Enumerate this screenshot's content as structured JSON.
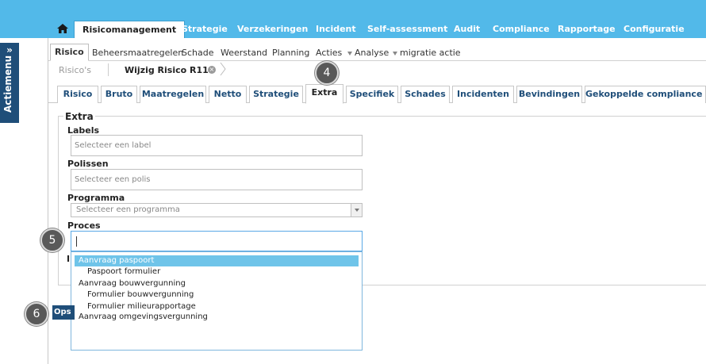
{
  "topnav": {
    "active": "Risicomanagement",
    "tabs": [
      "Strategie",
      "Verzekeringen",
      "Incident",
      "Self-assessment",
      "Audit",
      "Compliance",
      "Rapportage",
      "Configuratie"
    ]
  },
  "actiemenu": {
    "label": "Actiemenu",
    "chevron": "»"
  },
  "subnav": {
    "active": "Risico",
    "items": [
      "Beheersmaatregelen",
      "Schade",
      "Weerstand",
      "Planning",
      "Acties",
      "Analyse",
      "migratie actie"
    ]
  },
  "breadcrumb": {
    "parent": "Risico's",
    "current": "Wijzig Risico R11*"
  },
  "badges": [
    "4",
    "5",
    "6"
  ],
  "detail_tabs": {
    "items": [
      "Risico",
      "Bruto",
      "Maatregelen",
      "Netto",
      "Strategie",
      "Extra",
      "Specifiek",
      "Schades",
      "Incidenten",
      "Bevindingen",
      "Gekoppelde compliance it..."
    ],
    "active_index": 5
  },
  "form": {
    "legend": "Extra",
    "labels_label": "Labels",
    "labels_placeholder": "Selecteer een label",
    "polissen_label": "Polissen",
    "polissen_placeholder": "Selecteer een polis",
    "programma_label": "Programma",
    "programma_placeholder": "Selecteer een programma",
    "proces_label": "Proces",
    "proces_value": "",
    "obscured_label": "I"
  },
  "dropdown": {
    "options": [
      {
        "label": "Aanvraag paspoort",
        "level": 0,
        "highlighted": true
      },
      {
        "label": "Paspoort formulier",
        "level": 1,
        "highlighted": false
      },
      {
        "label": "Aanvraag bouwvergunning",
        "level": 0,
        "highlighted": false
      },
      {
        "label": "Formulier bouwvergunning",
        "level": 1,
        "highlighted": false
      },
      {
        "label": "Formulier milieurapportage",
        "level": 1,
        "highlighted": false
      },
      {
        "label": "Aanvraag omgevingsvergunning",
        "level": 0,
        "highlighted": false
      }
    ]
  },
  "ops_bar": {
    "label": "Ops"
  },
  "colors": {
    "topnav": "#52b9e9",
    "accent": "#1f4e79",
    "highlight": "#6fc4e9"
  }
}
